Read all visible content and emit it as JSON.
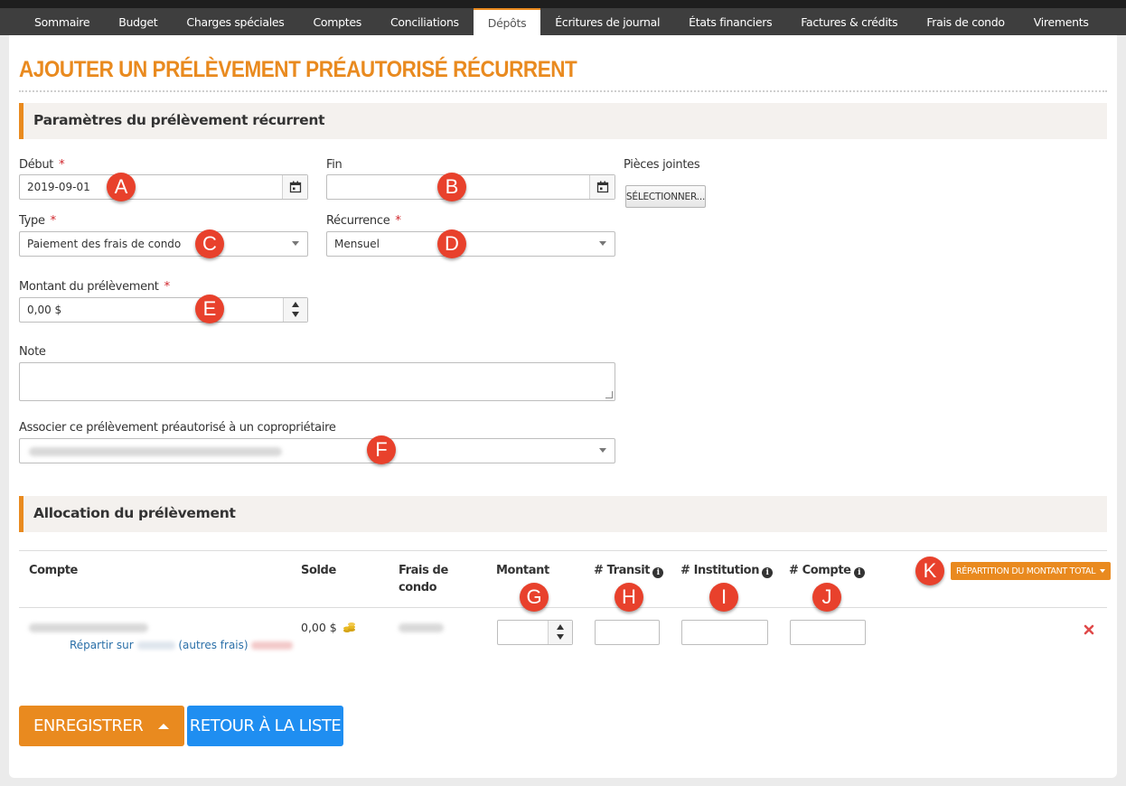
{
  "nav": {
    "tabs": [
      {
        "label": "Sommaire"
      },
      {
        "label": "Budget"
      },
      {
        "label": "Charges spéciales"
      },
      {
        "label": "Comptes"
      },
      {
        "label": "Conciliations"
      },
      {
        "label": "Dépôts"
      },
      {
        "label": "Écritures de journal"
      },
      {
        "label": "États financiers"
      },
      {
        "label": "Factures & crédits"
      },
      {
        "label": "Frais de condo"
      },
      {
        "label": "Virements"
      }
    ],
    "active": "Dépôts"
  },
  "page": {
    "title": "AJOUTER UN PRÉLÈVEMENT PRÉAUTORISÉ RÉCURRENT"
  },
  "params_section": {
    "title": "Paramètres du prélèvement récurrent"
  },
  "form": {
    "start": {
      "label": "Début",
      "required": "*",
      "value": "2019-09-01"
    },
    "end": {
      "label": "Fin",
      "value": ""
    },
    "attachments": {
      "label": "Pièces jointes",
      "button": "SÉLECTIONNER..."
    },
    "type": {
      "label": "Type",
      "required": "*",
      "value": "Paiement des frais de condo"
    },
    "recurrence": {
      "label": "Récurrence",
      "required": "*",
      "value": "Mensuel"
    },
    "amount": {
      "label": "Montant du prélèvement",
      "required": "*",
      "value": "0,00 $"
    },
    "note": {
      "label": "Note",
      "value": ""
    },
    "owner": {
      "label": "Associer ce prélèvement préautorisé à un copropriétaire"
    }
  },
  "allocation_section": {
    "title": "Allocation du prélèvement"
  },
  "table": {
    "headers": {
      "account": "Compte",
      "balance": "Solde",
      "fees_line1": "Frais de",
      "fees_line2": "condo",
      "amount": "Montant",
      "transit": "# Transit",
      "institution": "# Institution",
      "account_no": "# Compte"
    },
    "split_button": "RÉPARTITION DU MONTANT TOTAL",
    "row": {
      "balance": "0,00 $",
      "split_prefix": "Répartir sur",
      "split_suffix": "(autres frais)"
    }
  },
  "markers": [
    "A",
    "B",
    "C",
    "D",
    "E",
    "F",
    "G",
    "H",
    "I",
    "J",
    "K"
  ],
  "actions": {
    "save": "ENREGISTRER",
    "back": "RETOUR À LA LISTE"
  },
  "colors": {
    "accent": "#e98a1f",
    "primary": "#1f8ef1",
    "marker": "#e8412c",
    "required": "#d0242a"
  }
}
